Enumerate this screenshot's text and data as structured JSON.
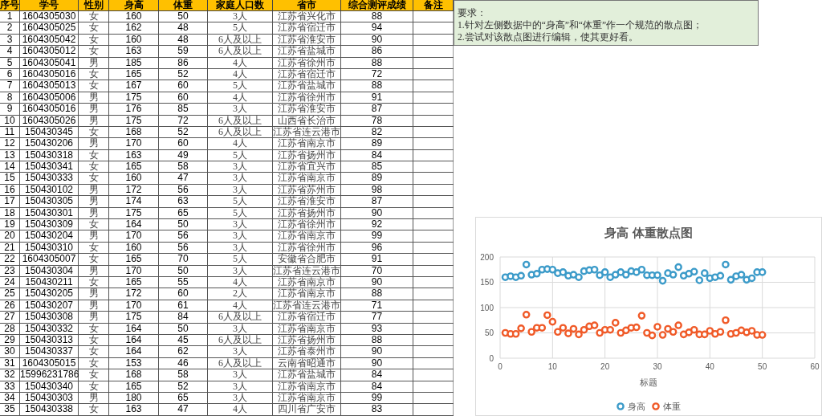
{
  "table": {
    "columns": [
      "序号",
      "学号",
      "性别",
      "身高",
      "体重",
      "家庭人口数",
      "省市",
      "综合测评成绩",
      "备注"
    ],
    "rows": [
      [
        "1",
        "1604305030",
        "女",
        "160",
        "50",
        "3人",
        "江苏省兴化市",
        "88"
      ],
      [
        "2",
        "1604305025",
        "女",
        "162",
        "48",
        "5人",
        "江苏省宿迁市",
        "94"
      ],
      [
        "3",
        "1604305042",
        "女",
        "160",
        "48",
        "6人及以上",
        "江苏省淮安市",
        "90"
      ],
      [
        "4",
        "1604305012",
        "女",
        "163",
        "59",
        "6人及以上",
        "江苏省盐城市",
        "86"
      ],
      [
        "5",
        "1604305041",
        "男",
        "185",
        "86",
        "4人",
        "江苏省徐州市",
        "88"
      ],
      [
        "6",
        "1604305016",
        "女",
        "165",
        "52",
        "4人",
        "江苏省宿迁市",
        "72"
      ],
      [
        "7",
        "1604305013",
        "女",
        "167",
        "60",
        "5人",
        "江苏省盐城市",
        "88"
      ],
      [
        "8",
        "1604305006",
        "男",
        "175",
        "60",
        "4人",
        "江苏省徐州市",
        "91"
      ],
      [
        "9",
        "1604305016",
        "男",
        "176",
        "85",
        "3人",
        "江苏省淮安市",
        "87"
      ],
      [
        "10",
        "1604305026",
        "男",
        "175",
        "72",
        "6人及以上",
        "山西省长治市",
        "78"
      ],
      [
        "11",
        "150430345",
        "女",
        "168",
        "52",
        "6人及以上",
        "江苏省连云港市",
        "82"
      ],
      [
        "12",
        "150430206",
        "男",
        "170",
        "60",
        "4人",
        "江苏省南京市",
        "89"
      ],
      [
        "13",
        "150430318",
        "女",
        "163",
        "49",
        "5人",
        "江苏省扬州市",
        "84"
      ],
      [
        "14",
        "150430341",
        "女",
        "165",
        "58",
        "3人",
        "江苏省宜兴市",
        "85"
      ],
      [
        "15",
        "150430333",
        "女",
        "160",
        "47",
        "3人",
        "江苏省南京市",
        "89"
      ],
      [
        "16",
        "150430102",
        "男",
        "172",
        "56",
        "3人",
        "江苏省苏州市",
        "98"
      ],
      [
        "17",
        "150430305",
        "男",
        "174",
        "63",
        "5人",
        "江苏省淮安市",
        "87"
      ],
      [
        "18",
        "150430301",
        "男",
        "175",
        "65",
        "5人",
        "江苏省扬州市",
        "90"
      ],
      [
        "19",
        "150430309",
        "女",
        "164",
        "50",
        "3人",
        "江苏省徐州市",
        "92"
      ],
      [
        "20",
        "150430204",
        "男",
        "170",
        "56",
        "3人",
        "江苏省南京市",
        "99"
      ],
      [
        "21",
        "150430310",
        "女",
        "160",
        "56",
        "3人",
        "江苏省徐州市",
        "96"
      ],
      [
        "22",
        "1604305007",
        "女",
        "165",
        "70",
        "5人",
        "安徽省合肥市",
        "91"
      ],
      [
        "23",
        "150430304",
        "男",
        "170",
        "50",
        "3人",
        "江苏省连云港市",
        "70"
      ],
      [
        "24",
        "150430211",
        "女",
        "165",
        "55",
        "4人",
        "江苏省南京市",
        "90"
      ],
      [
        "25",
        "150430205",
        "男",
        "172",
        "60",
        "2人",
        "江苏省南京市",
        "88"
      ],
      [
        "26",
        "150430207",
        "男",
        "170",
        "61",
        "4人",
        "江苏省连云港市",
        "71"
      ],
      [
        "27",
        "150430308",
        "男",
        "175",
        "84",
        "6人及以上",
        "江苏省宿迁市",
        "77"
      ],
      [
        "28",
        "150430332",
        "女",
        "164",
        "50",
        "3人",
        "江苏省南京市",
        "93"
      ],
      [
        "29",
        "150430313",
        "女",
        "164",
        "45",
        "6人及以上",
        "江苏省扬州市",
        "88"
      ],
      [
        "30",
        "150430337",
        "女",
        "164",
        "62",
        "3人",
        "江苏省泰州市",
        "90"
      ],
      [
        "31",
        "1604305015",
        "女",
        "153",
        "46",
        "6人及以上",
        "云南省昭通市",
        "90"
      ],
      [
        "32",
        "15996231786",
        "女",
        "168",
        "58",
        "3人",
        "江苏省盐城市",
        "84"
      ],
      [
        "33",
        "150430340",
        "女",
        "165",
        "52",
        "3人",
        "江苏省南京市",
        "84"
      ],
      [
        "34",
        "150430303",
        "男",
        "180",
        "65",
        "3人",
        "江苏省南京市",
        "99"
      ],
      [
        "35",
        "150430338",
        "女",
        "163",
        "47",
        "4人",
        "四川省广安市",
        "83"
      ]
    ]
  },
  "note": {
    "lines": [
      "要求：",
      "1.针对左侧数据中的“身高”和“体重”作一个规范的散点图；",
      "2.尝试对该散点图进行编辑，使其更好看。"
    ]
  },
  "chart": {
    "chart_data": {
      "type": "scatter",
      "title": "身高 体重散点图",
      "xlabel": "标题",
      "x": [
        1,
        2,
        3,
        4,
        5,
        6,
        7,
        8,
        9,
        10,
        11,
        12,
        13,
        14,
        15,
        16,
        17,
        18,
        19,
        20,
        21,
        22,
        23,
        24,
        25,
        26,
        27,
        28,
        29,
        30,
        31,
        32,
        33,
        34,
        35,
        36,
        37,
        38,
        39,
        40,
        41,
        42,
        43,
        44,
        45,
        46,
        47,
        48,
        49,
        50
      ],
      "series": [
        {
          "name": "身高",
          "color": "#3c9bc9",
          "values": [
            160,
            162,
            160,
            163,
            185,
            165,
            167,
            175,
            176,
            175,
            168,
            170,
            163,
            165,
            160,
            172,
            174,
            175,
            164,
            170,
            160,
            165,
            170,
            165,
            172,
            170,
            175,
            164,
            164,
            164,
            153,
            168,
            165,
            180,
            163,
            167,
            171,
            154,
            168,
            158,
            160,
            163,
            185,
            155,
            162,
            165,
            155,
            158,
            170,
            170
          ]
        },
        {
          "name": "体重",
          "color": "#f05a28",
          "values": [
            50,
            48,
            48,
            59,
            86,
            52,
            60,
            60,
            85,
            72,
            52,
            60,
            49,
            58,
            47,
            56,
            63,
            65,
            50,
            56,
            56,
            70,
            50,
            55,
            60,
            61,
            84,
            50,
            45,
            62,
            46,
            58,
            52,
            65,
            47,
            51,
            56,
            47,
            47,
            54,
            48,
            52,
            75,
            48,
            50,
            55,
            51,
            54,
            46,
            46
          ]
        }
      ],
      "grid": true,
      "legend": "bottom",
      "xlim": [
        0,
        60
      ],
      "ylim": [
        0,
        200
      ],
      "xticks": [
        0,
        10,
        20,
        30,
        40,
        50,
        60
      ],
      "yticks": [
        0,
        50,
        100,
        150,
        200
      ]
    }
  }
}
